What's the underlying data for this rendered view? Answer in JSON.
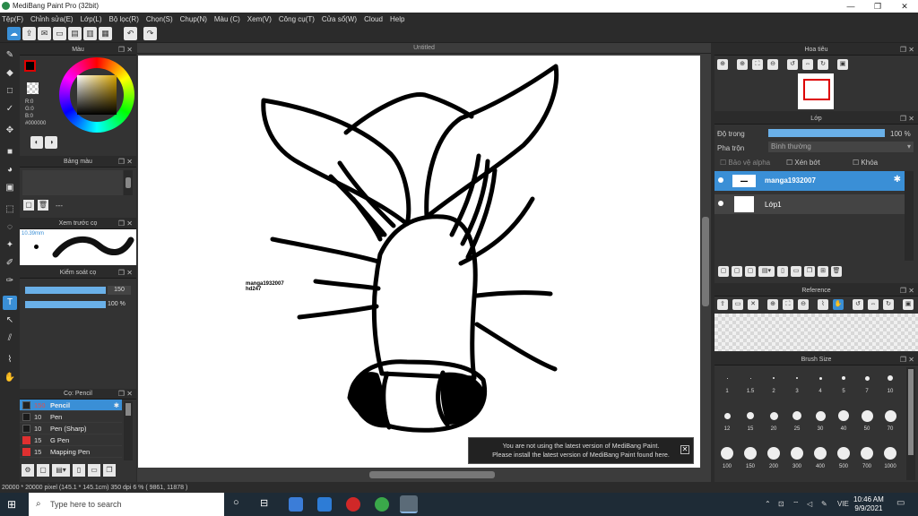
{
  "window": {
    "title": "MediBang Paint Pro (32bit)"
  },
  "menu": [
    "Tệp(F)",
    "Chỉnh sửa(E)",
    "Lớp(L)",
    "Bộ lọc(R)",
    "Chọn(S)",
    "Chụp(N)",
    "Màu (C)",
    "Xem(V)",
    "Công cụ(T)",
    "Cửa sổ(W)",
    "Cloud",
    "Help"
  ],
  "color_panel": {
    "title": "Màu",
    "r": "R:0",
    "g": "G:0",
    "b": "B:0",
    "hex": "#000000"
  },
  "palette_panel": {
    "title": "Bảng màu",
    "dash": "---"
  },
  "preview_panel": {
    "title": "Xem trước cọ",
    "size": "10.39mm"
  },
  "brush_control": {
    "title": "Kiểm soát cọ",
    "size": "150",
    "opacity": "100 %"
  },
  "brush_panel": {
    "title": "Cọ: Pencil",
    "items": [
      {
        "size": "150",
        "name": "Pencil",
        "color": "#e03030"
      },
      {
        "size": "10",
        "name": "Pen",
        "color": "#1a1a1a"
      },
      {
        "size": "10",
        "name": "Pen (Sharp)",
        "color": "#1a1a1a"
      },
      {
        "size": "15",
        "name": "G Pen",
        "color": "#e03030"
      },
      {
        "size": "15",
        "name": "Mapping Pen",
        "color": "#e03030"
      }
    ]
  },
  "canvas": {
    "tab": "Untitled",
    "text1": "manga1932007",
    "text2": "hd247"
  },
  "notification": {
    "line1": "You are not using the latest version of MediBang Paint.",
    "line2": "Please install the latest version of MediBang Paint found here.",
    "close": "✕"
  },
  "statusbar": {
    "text": "20000 * 20000 pixel  (145.1 * 145.1cm)  350 dpi  6 %  ( 9861, 11878 )"
  },
  "navigator": {
    "title": "Hoa tiêu"
  },
  "layer_panel": {
    "title": "Lớp",
    "opacity_label": "Độ trong",
    "opacity_value": "100 %",
    "blend_label": "Pha trộn",
    "blend_value": "Bình thường",
    "protect_alpha": "Bảo vệ alpha",
    "clipping": "Xén bớt",
    "lock": "Khóa",
    "layers": [
      {
        "name": "manga1932007",
        "selected": true
      },
      {
        "name": "Lớp1",
        "selected": false
      }
    ]
  },
  "reference": {
    "title": "Reference"
  },
  "brush_size": {
    "title": "Brush Size",
    "sizes": [
      "1",
      "1.5",
      "2",
      "3",
      "4",
      "5",
      "7",
      "10",
      "12",
      "15",
      "20",
      "25",
      "30",
      "40",
      "50",
      "70",
      "100",
      "150",
      "200",
      "300",
      "400",
      "500",
      "700",
      "1000"
    ]
  },
  "taskbar": {
    "search_placeholder": "Type here to search",
    "lang": "VIE",
    "time": "10:46 AM",
    "date": "9/9/2021"
  }
}
